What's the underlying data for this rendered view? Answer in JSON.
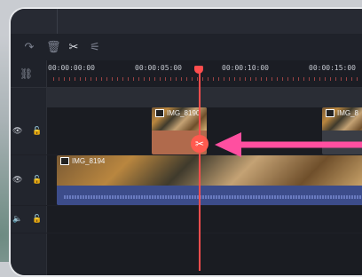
{
  "toolbar": {
    "icons": [
      "redo-icon",
      "delete-icon",
      "scissors-icon",
      "adjust-icon"
    ]
  },
  "ruler": {
    "timecodes": [
      "00:00:00:00",
      "00:00:05:00",
      "00:00:10:00",
      "00:00:15:00"
    ]
  },
  "tracks": {
    "pip_clip_left": {
      "name": "IMG_8190"
    },
    "pip_clip_right": {
      "name": "IMG_8"
    },
    "main_clip": {
      "name": "IMG_8194"
    }
  },
  "colors": {
    "accent": "#ff4d4d",
    "arrow": "#ff4fa0",
    "pip_clip": "#b06a4c",
    "audio": "#3c4c8a"
  }
}
